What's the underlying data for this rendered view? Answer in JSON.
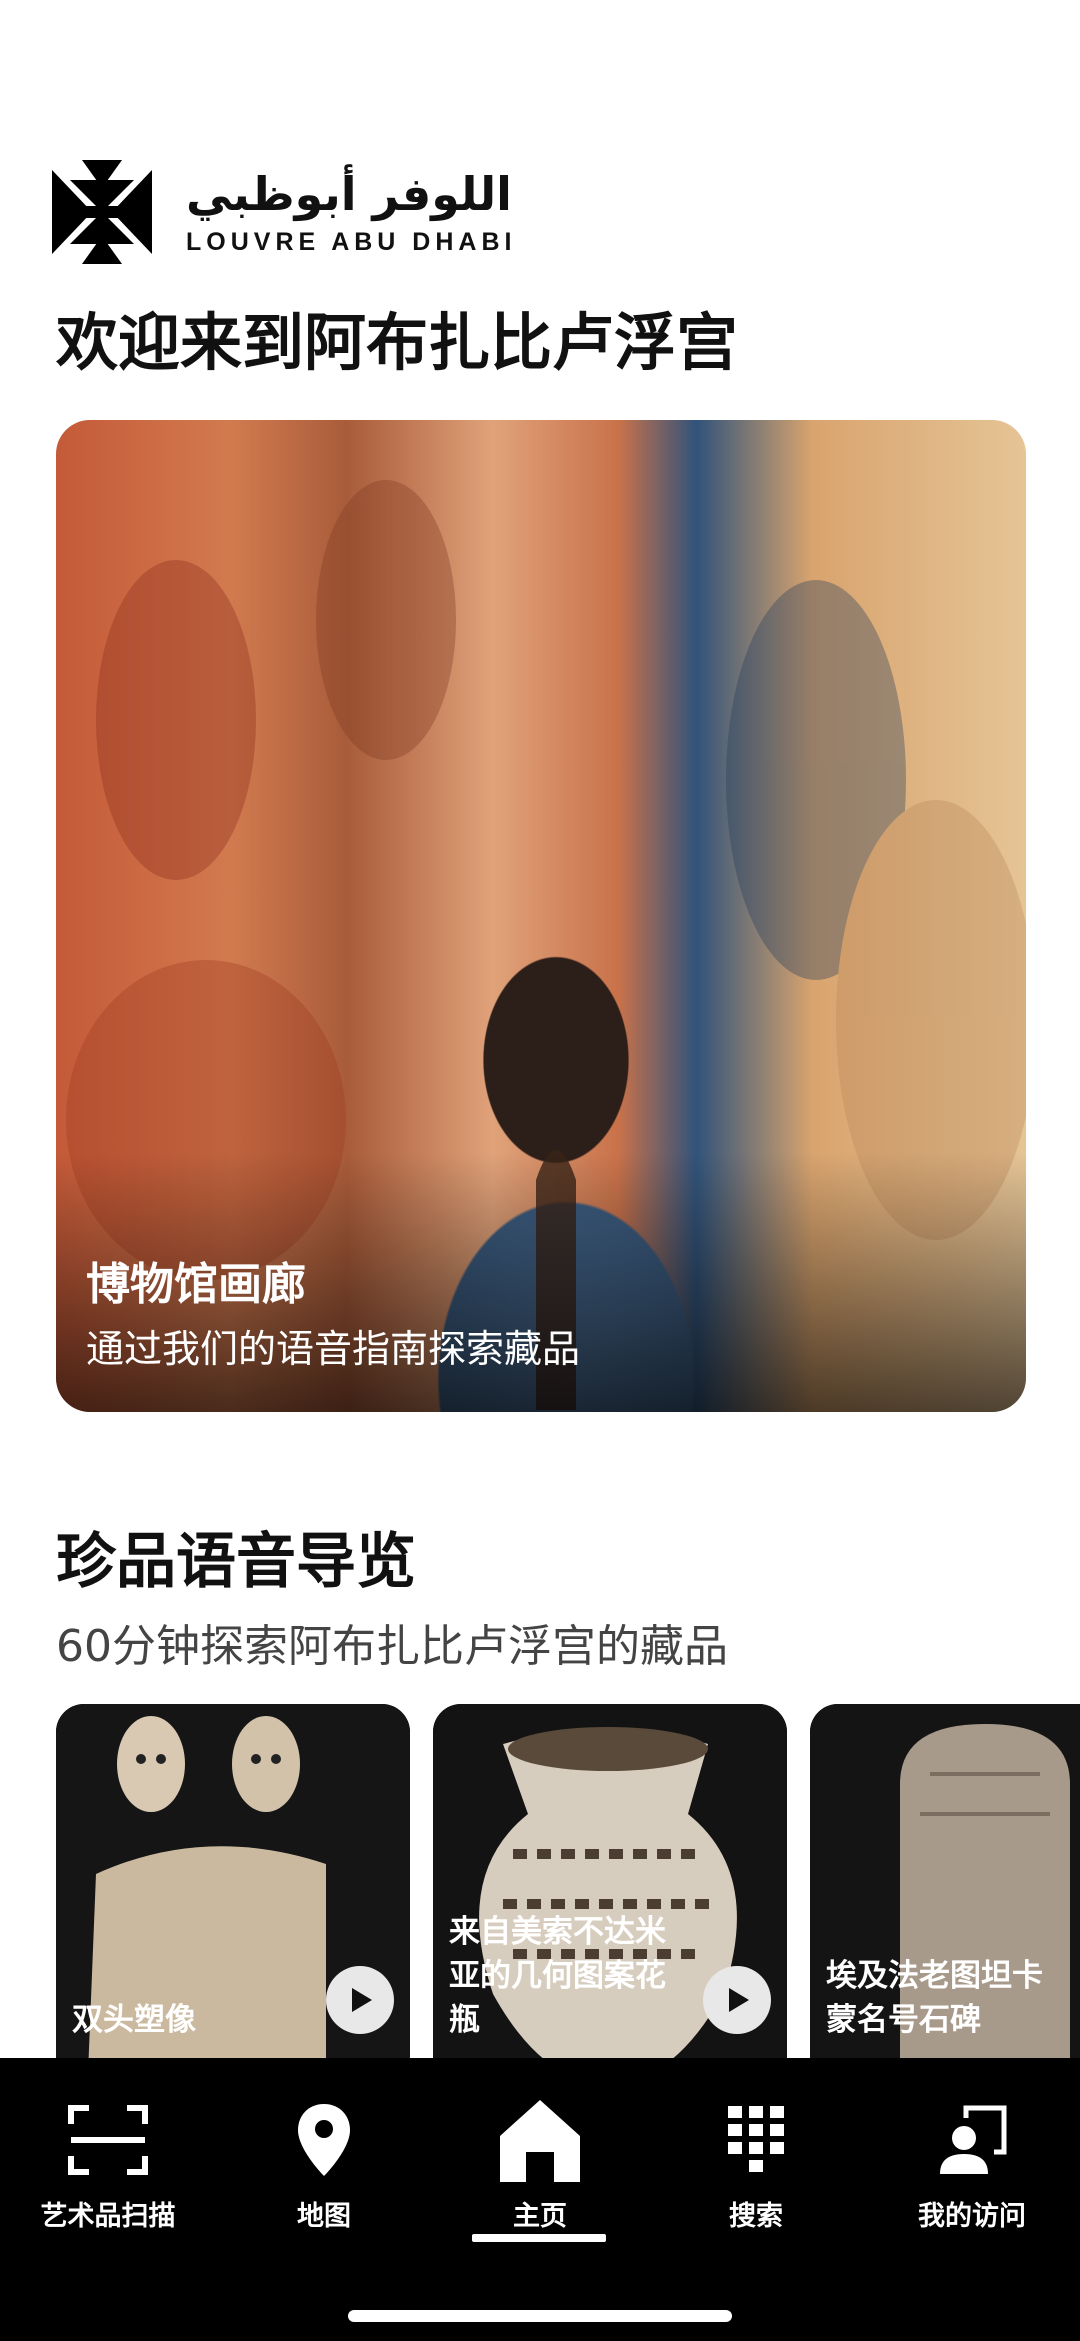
{
  "header": {
    "logo_ar": "اللوفر أبوظبي",
    "logo_en": "LOUVRE ABU DHABI",
    "welcome": "欢迎来到阿布扎比卢浮宫"
  },
  "hero": {
    "title": "博物馆画廊",
    "subtitle": "通过我们的语音指南探索藏品"
  },
  "section": {
    "title": "珍品语音导览",
    "subtitle": "60分钟探索阿布扎比卢浮宫的藏品",
    "cards": [
      {
        "label": "双头塑像"
      },
      {
        "label": "来自美索不达米亚的几何图案花瓶"
      },
      {
        "label": "埃及法老图坦卡蒙名号石碑"
      }
    ]
  },
  "nav": {
    "items": [
      {
        "label": "艺术品扫描",
        "icon": "scan-icon"
      },
      {
        "label": "地图",
        "icon": "map-pin-icon"
      },
      {
        "label": "主页",
        "icon": "home-icon"
      },
      {
        "label": "搜索",
        "icon": "keypad-icon"
      },
      {
        "label": "我的访问",
        "icon": "profile-icon"
      }
    ],
    "active": "主页"
  }
}
